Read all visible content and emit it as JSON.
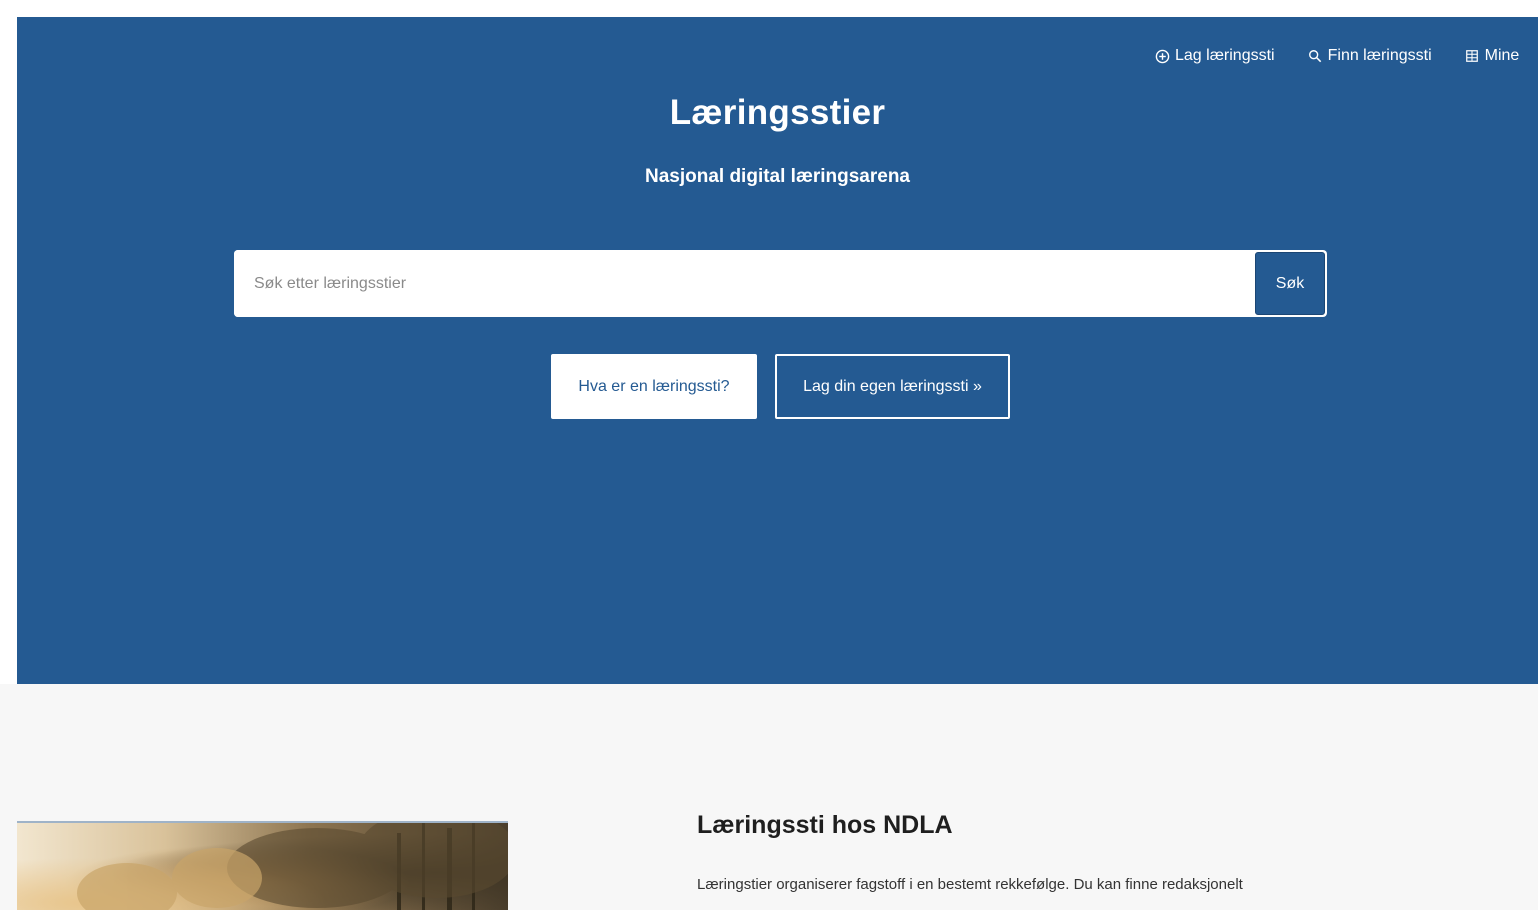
{
  "nav": {
    "items": [
      {
        "icon": "plus-circle-icon",
        "label": "Lag læringssti"
      },
      {
        "icon": "search-icon",
        "label": "Finn læringssti"
      },
      {
        "icon": "grid-icon",
        "label": "Mine"
      }
    ]
  },
  "hero": {
    "title": "Læringsstier",
    "subtitle": "Nasjonal digital læringsarena",
    "search_placeholder": "Søk etter læringsstier",
    "search_button": "Søk",
    "what_is_button": "Hva er en læringssti?",
    "create_button": "Lag din egen læringssti »"
  },
  "info": {
    "title": "Læringssti hos NDLA",
    "text": "Læringstier organiserer fagstoff i en bestemt rekkefølge. Du kan finne redaksjonelt"
  },
  "colors": {
    "hero_bg": "#245a92",
    "lower_bg": "#f7f7f7"
  }
}
